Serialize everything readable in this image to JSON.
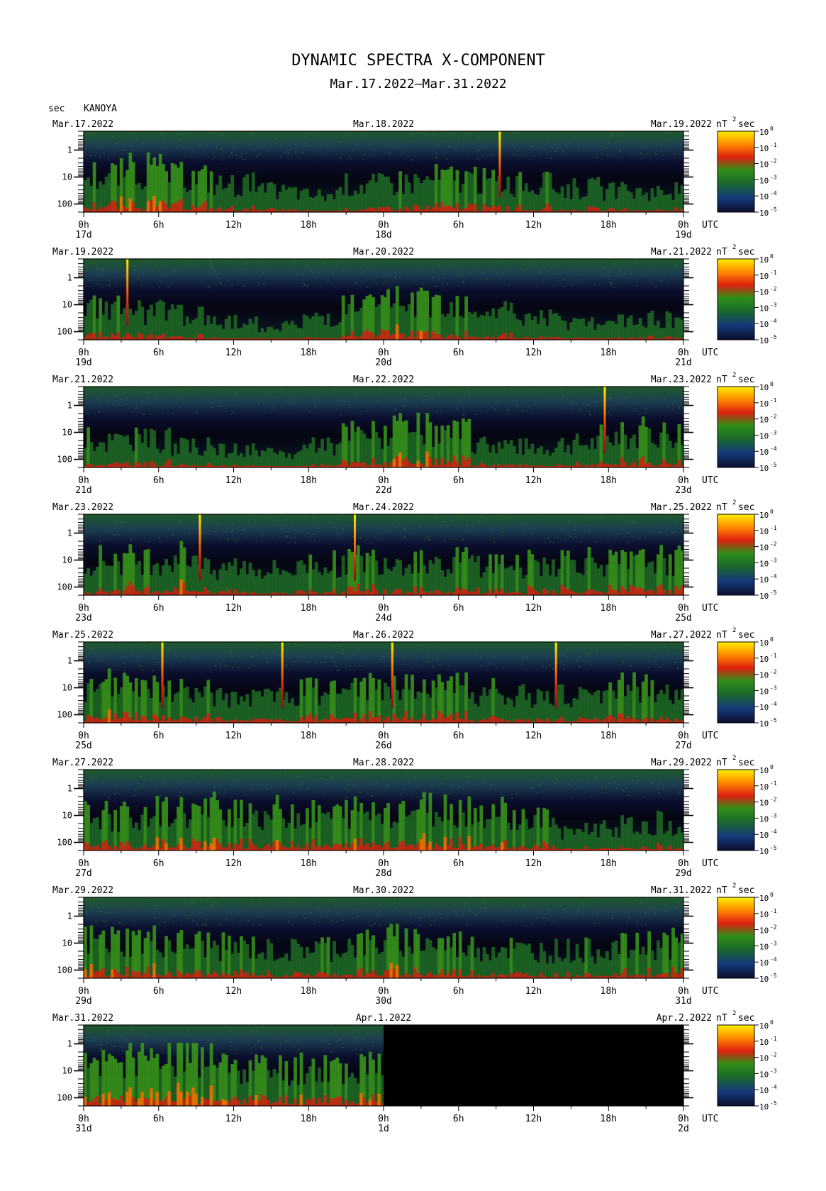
{
  "title": "DYNAMIC SPECTRA X-COMPONENT",
  "subtitle": "Mar.17.2022–Mar.31.2022",
  "ylabel": "sec",
  "station": "KANOYA",
  "colorbar": {
    "unit_label": "nT",
    "unit_power": "2",
    "unit_suffix": "sec",
    "ticks": [
      {
        "base": "10",
        "exp": "0"
      },
      {
        "base": "10",
        "exp": "-1"
      },
      {
        "base": "10",
        "exp": "-2"
      },
      {
        "base": "10",
        "exp": "-3"
      },
      {
        "base": "10",
        "exp": "-4"
      },
      {
        "base": "10",
        "exp": "-5"
      }
    ],
    "colors": [
      "#0a0d2e",
      "#153a7a",
      "#1a6a2a",
      "#2f8f18",
      "#e02010",
      "#ff8a00",
      "#ffee00"
    ]
  },
  "y_ticks": [
    "1",
    "10",
    "100"
  ],
  "x_ticks": [
    "0h",
    "6h",
    "12h",
    "18h",
    "0h",
    "6h",
    "12h",
    "18h",
    "0h"
  ],
  "utc_label": "UTC",
  "chart_data": [
    {
      "type": "heatmap",
      "left_date": "Mar.17.2022",
      "mid_date": "Mar.18.2022",
      "right_date": "Mar.19.2022",
      "day_labels": [
        "17d",
        "18d",
        "19d"
      ],
      "xlabel": "UTC",
      "ylabel": "sec",
      "ylim_sec": [
        0.2,
        200
      ],
      "spikes_hours": [
        33.3
      ],
      "activity": [
        0.55,
        0.6,
        0.5,
        0.4,
        0.3,
        0.25,
        0.4,
        0.45,
        0.5,
        0.45,
        0.4,
        0.35,
        0.3,
        0.3
      ],
      "no_data_from_hours": null
    },
    {
      "type": "heatmap",
      "left_date": "Mar.19.2022",
      "mid_date": "Mar.20.2022",
      "right_date": "Mar.21.2022",
      "day_labels": [
        "19d",
        "20d",
        "21d"
      ],
      "xlabel": "UTC",
      "ylabel": "sec",
      "ylim_sec": [
        0.2,
        200
      ],
      "spikes_hours": [
        3.5
      ],
      "activity": [
        0.45,
        0.4,
        0.35,
        0.25,
        0.2,
        0.3,
        0.45,
        0.55,
        0.5,
        0.4,
        0.3,
        0.25,
        0.25,
        0.3
      ],
      "no_data_from_hours": null
    },
    {
      "type": "heatmap",
      "left_date": "Mar.21.2022",
      "mid_date": "Mar.22.2022",
      "right_date": "Mar.23.2022",
      "day_labels": [
        "21d",
        "22d",
        "23d"
      ],
      "xlabel": "UTC",
      "ylabel": "sec",
      "ylim_sec": [
        0.2,
        200
      ],
      "spikes_hours": [
        41.7
      ],
      "activity": [
        0.4,
        0.4,
        0.3,
        0.25,
        0.2,
        0.3,
        0.5,
        0.55,
        0.5,
        0.35,
        0.3,
        0.35,
        0.45,
        0.5
      ],
      "no_data_from_hours": null
    },
    {
      "type": "heatmap",
      "left_date": "Mar.23.2022",
      "mid_date": "Mar.24.2022",
      "right_date": "Mar.25.2022",
      "day_labels": [
        "23d",
        "24d",
        "25d"
      ],
      "xlabel": "UTC",
      "ylabel": "sec",
      "ylim_sec": [
        0.2,
        200
      ],
      "spikes_hours": [
        9.3,
        21.7
      ],
      "activity": [
        0.5,
        0.5,
        0.55,
        0.4,
        0.35,
        0.45,
        0.5,
        0.5,
        0.5,
        0.45,
        0.45,
        0.5,
        0.45,
        0.5
      ],
      "no_data_from_hours": null
    },
    {
      "type": "heatmap",
      "left_date": "Mar.25.2022",
      "mid_date": "Mar.26.2022",
      "right_date": "Mar.27.2022",
      "day_labels": [
        "25d",
        "26d",
        "27d"
      ],
      "xlabel": "UTC",
      "ylabel": "sec",
      "ylim_sec": [
        0.2,
        200
      ],
      "spikes_hours": [
        6.3,
        15.9,
        24.7,
        37.8
      ],
      "activity": [
        0.55,
        0.5,
        0.45,
        0.35,
        0.35,
        0.45,
        0.5,
        0.55,
        0.5,
        0.45,
        0.4,
        0.4,
        0.5,
        0.5
      ],
      "no_data_from_hours": null
    },
    {
      "type": "heatmap",
      "left_date": "Mar.27.2022",
      "mid_date": "Mar.28.2022",
      "right_date": "Mar.29.2022",
      "day_labels": [
        "27d",
        "28d",
        "29d"
      ],
      "xlabel": "UTC",
      "ylabel": "sec",
      "ylim_sec": [
        0.2,
        200
      ],
      "spikes_hours": [],
      "activity": [
        0.5,
        0.55,
        0.55,
        0.6,
        0.55,
        0.5,
        0.55,
        0.6,
        0.6,
        0.55,
        0.45,
        0.3,
        0.35,
        0.4
      ],
      "no_data_from_hours": null
    },
    {
      "type": "heatmap",
      "left_date": "Mar.29.2022",
      "mid_date": "Mar.30.2022",
      "right_date": "Mar.31.2022",
      "day_labels": [
        "29d",
        "30d",
        "31d"
      ],
      "xlabel": "UTC",
      "ylabel": "sec",
      "ylim_sec": [
        0.2,
        200
      ],
      "spikes_hours": [],
      "activity": [
        0.55,
        0.55,
        0.5,
        0.45,
        0.4,
        0.45,
        0.5,
        0.55,
        0.5,
        0.45,
        0.4,
        0.4,
        0.45,
        0.5
      ],
      "no_data_from_hours": null
    },
    {
      "type": "heatmap",
      "left_date": "Mar.31.2022",
      "mid_date": "Apr.1.2022",
      "right_date": "Apr.2.2022",
      "day_labels": [
        "31d",
        "1d",
        "2d"
      ],
      "xlabel": "UTC",
      "ylabel": "sec",
      "ylim_sec": [
        0.2,
        200
      ],
      "spikes_hours": [],
      "activity": [
        0.6,
        0.75,
        0.7,
        0.6,
        0.55,
        0.6,
        0.55,
        0.5,
        0,
        0,
        0,
        0,
        0,
        0
      ],
      "no_data_from_hours": 24
    }
  ]
}
